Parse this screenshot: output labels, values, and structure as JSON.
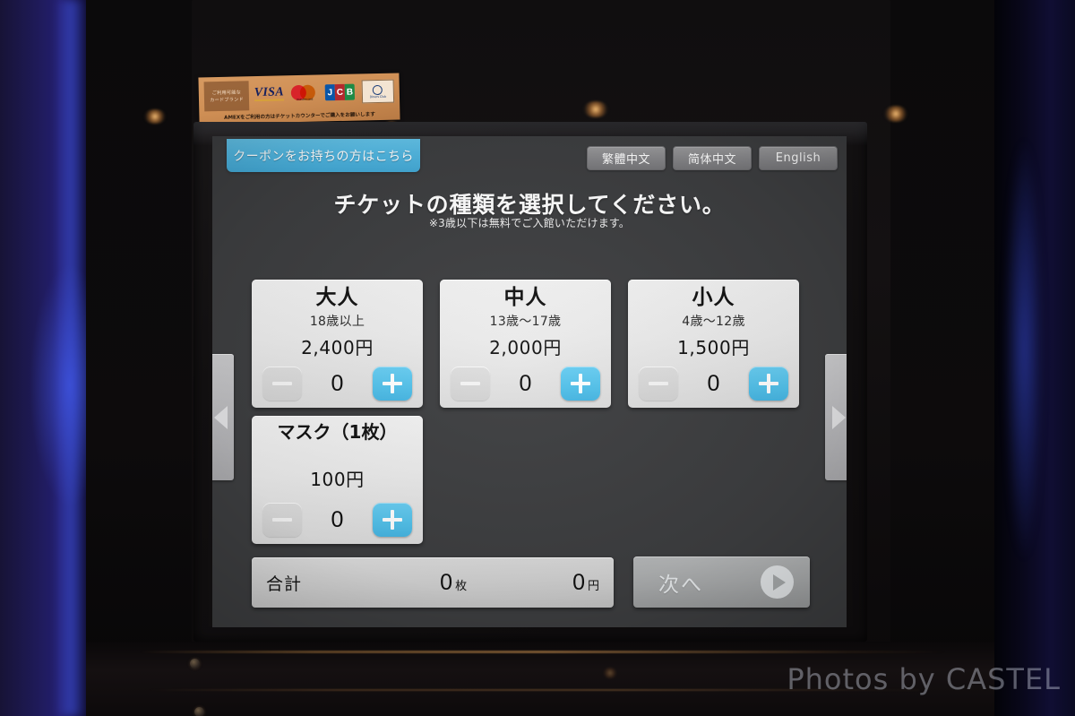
{
  "scene": {
    "watermark": "Photos by CASTEL"
  },
  "sticker": {
    "brand_box_line1": "ご利用可能な",
    "brand_box_line2": "カードブランド",
    "logos": [
      "VISA",
      "mastercard",
      "JCB",
      "Diners Club"
    ],
    "visa_label": "VISA",
    "mastercard_label": "mastercard",
    "jcb_j": "J",
    "jcb_c": "C",
    "jcb_b": "B",
    "diners_mark": "DC",
    "diners_label": "Diners Club",
    "note": "AMEXをご利用の方はチケットカウンターでご購入をお願いします"
  },
  "screen": {
    "coupon_button": "クーポンをお持ちの方はこちら",
    "languages": [
      {
        "label": "繁體中文"
      },
      {
        "label": "简体中文"
      },
      {
        "label": "English"
      }
    ],
    "headline": "チケットの種類を選択してください。",
    "subhead": "※3歳以下は無料でご入館いただけます。",
    "nav": {
      "prev_icon": "triangle-left-icon",
      "next_icon": "triangle-right-icon"
    },
    "tickets": [
      {
        "title": "大人",
        "age": "18歳以上",
        "price": "2,400円",
        "count": "0",
        "minus_label": "−",
        "plus_label": "＋"
      },
      {
        "title": "中人",
        "age": "13歳〜17歳",
        "price": "2,000円",
        "count": "0",
        "minus_label": "−",
        "plus_label": "＋"
      },
      {
        "title": "小人",
        "age": "4歳〜12歳",
        "price": "1,500円",
        "count": "0",
        "minus_label": "−",
        "plus_label": "＋"
      },
      {
        "title": "マスク（1枚）",
        "age": "",
        "price": "100円",
        "count": "0",
        "minus_label": "−",
        "plus_label": "＋"
      }
    ],
    "total": {
      "label": "合計",
      "qty_value": "0",
      "qty_unit": "枚",
      "amount_value": "0",
      "amount_unit": "円"
    },
    "next_button": {
      "label": "次へ",
      "icon": "play-circle-icon",
      "state": "disabled"
    }
  },
  "colors": {
    "coupon_blue": "#4FB5E0",
    "plus_blue": "#52C1EA",
    "screen_bg": "#3D3E40",
    "card_bg": "#ECECEC",
    "sticker_orange": "#CF8F55"
  }
}
